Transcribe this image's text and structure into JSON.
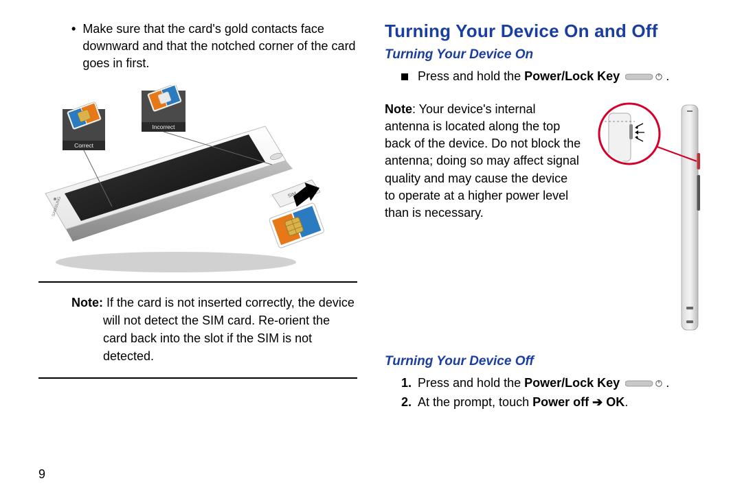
{
  "page_number": "9",
  "left": {
    "bullet": "Make sure that the card's gold contacts face downward and that the notched corner of the card goes in first.",
    "figure": {
      "correct_label": "Correct",
      "incorrect_label": "Incorrect",
      "sim_label": "SIM",
      "brand_label": "SAMSUNG"
    },
    "note_label": "Note:",
    "note_text": " If the card is not inserted correctly, the device will not detect the SIM card. Re-orient the card back into the slot if the SIM is not detected."
  },
  "right": {
    "h1": "Turning Your Device On and Off",
    "sub_on": "Turning Your Device On",
    "on_step_prefix": "Press and hold the ",
    "on_step_bold": "Power/Lock Key",
    "on_step_suffix": ".",
    "note_label": "Note",
    "note_text": ": Your device's internal antenna is located along the top back of the device. Do not block the antenna; doing so may affect signal quality and may cause the device to operate at a higher power level than is necessary.",
    "sub_off": "Turning Your Device Off",
    "off1_num": "1.",
    "off1_prefix": "Press and hold the ",
    "off1_bold": "Power/Lock Key",
    "off1_suffix": ".",
    "off2_num": "2.",
    "off2_prefix": "At the prompt, touch ",
    "off2_bold1": "Power off",
    "off2_arrow": " ➔ ",
    "off2_bold2": "OK",
    "off2_suffix": "."
  }
}
